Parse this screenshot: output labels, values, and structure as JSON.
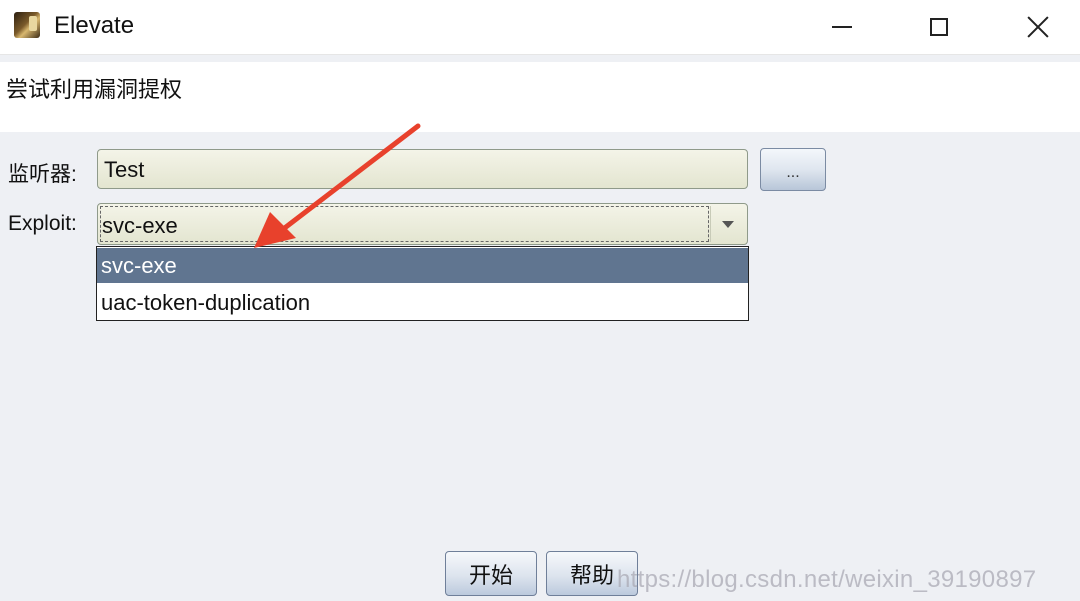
{
  "window": {
    "title": "Elevate"
  },
  "description": "尝试利用漏洞提权",
  "form": {
    "listener_label": "监听器:",
    "listener_value": "Test",
    "browse_label": "...",
    "exploit_label": "Exploit:",
    "exploit_value": "svc-exe",
    "exploit_options": [
      "svc-exe",
      "uac-token-duplication"
    ]
  },
  "buttons": {
    "start": "开始",
    "help": "帮助"
  },
  "watermark": "https://blog.csdn.net/weixin_39190897",
  "colors": {
    "selected_option": "#607590",
    "annotation_arrow": "#e8412c"
  }
}
